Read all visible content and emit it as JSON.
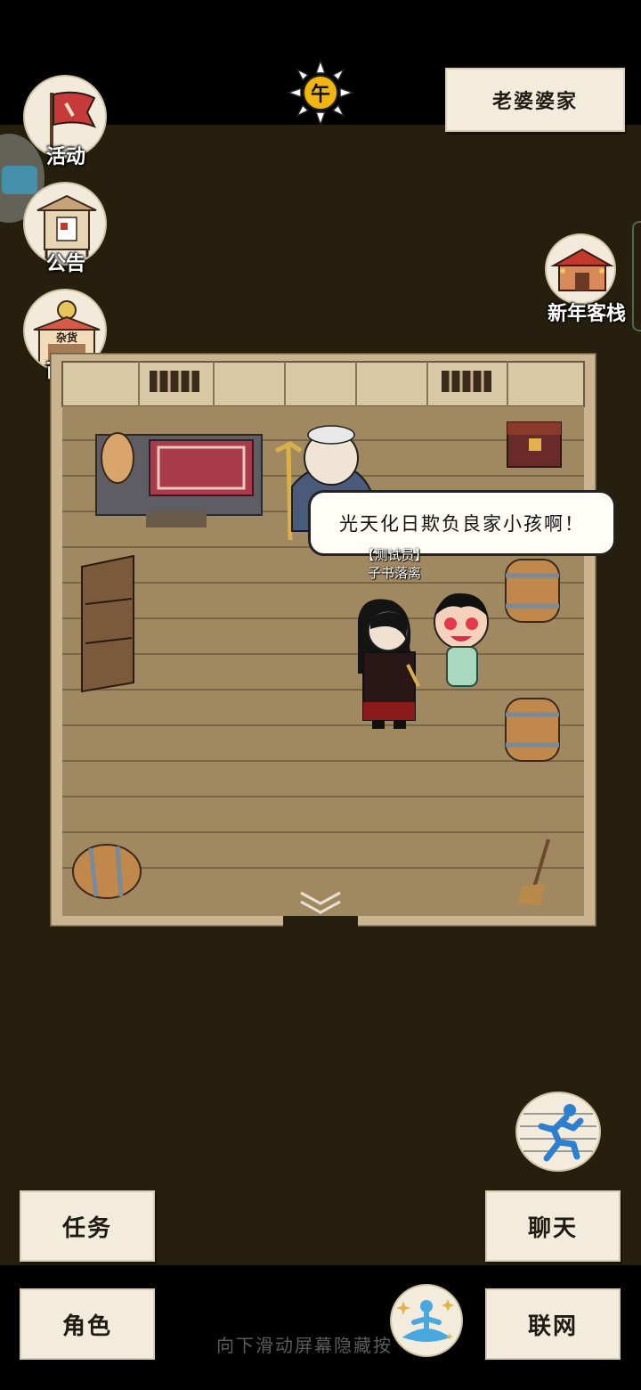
{
  "header": {
    "location": "老婆婆家",
    "time_of_day": "午"
  },
  "side_menu": {
    "events": "活动",
    "notice": "公告",
    "shop": "商城",
    "shop_sign": "杂货",
    "new_year_inn": "新年客栈"
  },
  "scene": {
    "speech": "光天化日欺负良家小孩啊！",
    "player_title": "【测试员】",
    "player_name": "子书落离"
  },
  "bottom": {
    "task": "任务",
    "chat": "聊天",
    "role": "角色",
    "network": "联网",
    "hint": "向下滑动屏幕隐藏按"
  },
  "colors": {
    "background": "#261f0d",
    "paper": "#f3ecdc",
    "floor": "#a08860",
    "wall": "#d9c8a6"
  }
}
